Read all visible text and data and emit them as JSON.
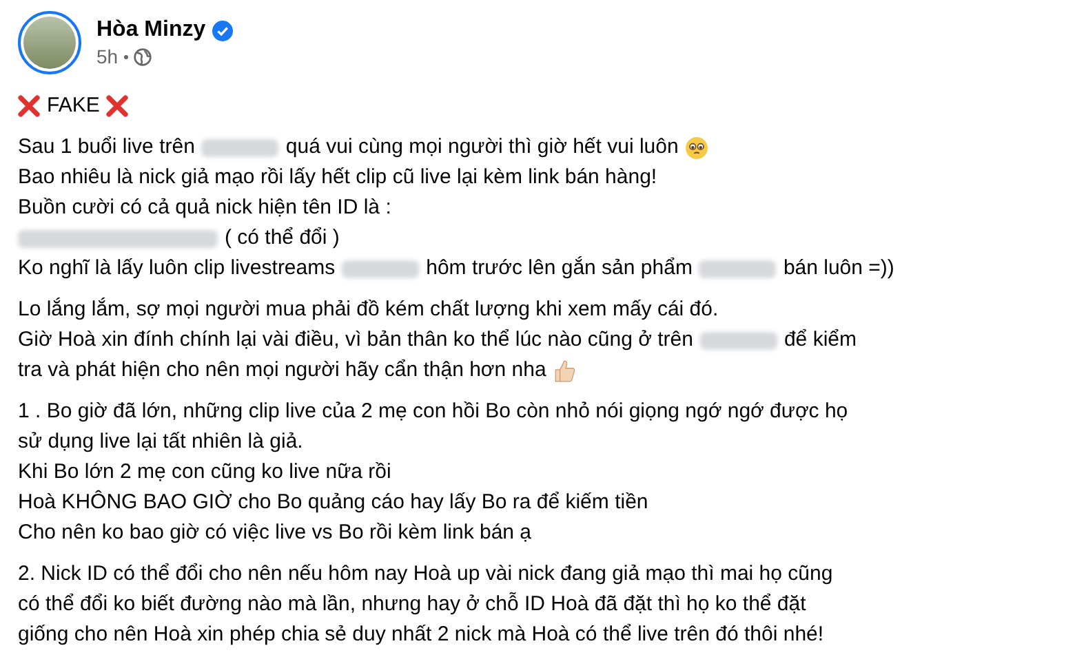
{
  "author": {
    "name": "Hòa Minzy",
    "verified": true,
    "time": "5h"
  },
  "headline": [
    {
      "kind": "cross"
    },
    {
      "kind": "text",
      "text": "FAKE"
    },
    {
      "kind": "cross"
    }
  ],
  "paragraphs": [
    [
      [
        {
          "kind": "text",
          "text": "Sau 1 buổi live trên"
        },
        {
          "kind": "blur"
        },
        {
          "kind": "text",
          "text": "quá vui cùng mọi người thì giờ hết vui luôn"
        },
        {
          "kind": "teary"
        }
      ],
      [
        {
          "kind": "text",
          "text": "Bao nhiêu là nick giả mạo rồi lấy hết clip cũ live lại kèm link bán hàng!"
        }
      ],
      [
        {
          "kind": "text",
          "text": "Buồn cười có cả quả nick hiện tên ID là :"
        }
      ],
      [
        {
          "kind": "blurhandle"
        },
        {
          "kind": "text",
          "text": "( có thể đổi )"
        }
      ],
      [
        {
          "kind": "text",
          "text": "Ko nghĩ là lấy luôn clip livestreams"
        },
        {
          "kind": "blur"
        },
        {
          "kind": "text",
          "text": "hôm trước lên gắn sản phẩm"
        },
        {
          "kind": "blur"
        },
        {
          "kind": "text",
          "text": "bán luôn =))"
        }
      ]
    ],
    [
      [
        {
          "kind": "text",
          "text": "Lo lắng lắm, sợ mọi người mua phải đồ kém chất lượng khi xem mấy cái đó."
        }
      ],
      [
        {
          "kind": "text",
          "text": "Giờ Hoà xin đính chính lại vài điều, vì bản thân ko thể lúc nào cũng ở trên"
        },
        {
          "kind": "blur"
        },
        {
          "kind": "text",
          "text": "để kiểm"
        }
      ],
      [
        {
          "kind": "text",
          "text": "tra và phát hiện cho nên mọi người hãy cẩn thận hơn nha"
        },
        {
          "kind": "thumb"
        }
      ]
    ],
    [
      [
        {
          "kind": "text",
          "text": "1 . Bo giờ đã lớn, những clip live của 2 mẹ con hồi Bo còn nhỏ nói giọng ngớ ngớ được họ"
        }
      ],
      [
        {
          "kind": "text",
          "text": "sử dụng live lại tất nhiên là giả."
        }
      ],
      [
        {
          "kind": "text",
          "text": "Khi Bo lớn 2 mẹ con cũng ko live nữa rồi"
        }
      ],
      [
        {
          "kind": "text",
          "text": "Hoà KHÔNG BAO GIỜ cho Bo quảng cáo hay lấy Bo ra để kiếm tiền"
        }
      ],
      [
        {
          "kind": "text",
          "text": "Cho nên ko bao giờ có việc live vs Bo rồi kèm link bán ạ"
        }
      ]
    ],
    [
      [
        {
          "kind": "text",
          "text": "2. Nick ID có thể đổi cho nên nếu hôm nay Hoà up vài nick đang giả mạo thì mai họ cũng"
        }
      ],
      [
        {
          "kind": "text",
          "text": "có thể đổi ko biết đường nào mà lần, nhưng hay ở chỗ ID Hoà đã đặt thì họ ko thể đặt"
        }
      ],
      [
        {
          "kind": "text",
          "text": "giống cho nên Hoà xin phép chia sẻ duy nhất 2 nick mà Hoà có thể live trên đó thôi nhé!"
        }
      ]
    ]
  ]
}
